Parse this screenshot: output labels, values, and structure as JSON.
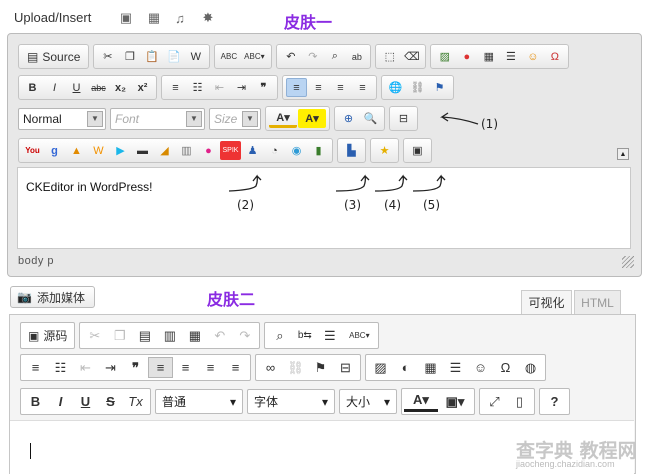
{
  "top": {
    "label": "Upload/Insert",
    "skin_title": "皮肤一"
  },
  "skin1": {
    "source_label": "Source",
    "format": "Normal",
    "font_placeholder": "Font",
    "size_placeholder": "Size",
    "editor_text": "CKEditor in WordPress!",
    "status": "body  p",
    "annotations": [
      "(1)",
      "(2)",
      "(3)",
      "(4)",
      "(5)"
    ]
  },
  "skin2": {
    "skin_title": "皮肤二",
    "add_media": "添加媒体",
    "tab_visual": "可视化",
    "tab_html": "HTML",
    "source_label": "源码",
    "format": "普通",
    "font": "字体",
    "size": "大小"
  },
  "watermark": {
    "main": "查字典 教程网",
    "sub": "jiaocheng.chazidian.com"
  }
}
